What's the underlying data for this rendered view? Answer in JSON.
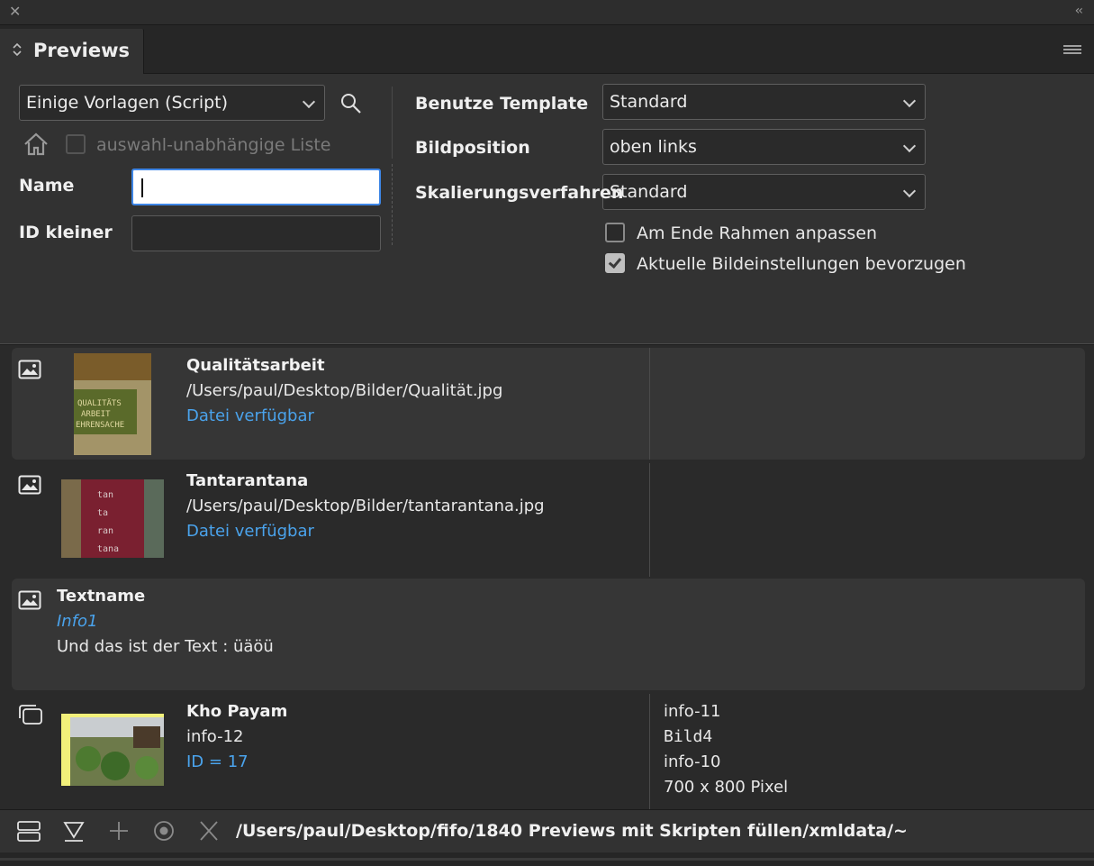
{
  "window": {
    "close_icon": "close-icon",
    "collapse_icon": "double-chevron-left-icon",
    "collapse_glyph": "‹‹"
  },
  "tab": {
    "title": "Previews"
  },
  "controls": {
    "preset_select": "Einige Vorlagen (Script)",
    "independent_list_label": "auswahl-unabhängige Liste",
    "name_label": "Name",
    "name_value": "",
    "id_label": "ID kleiner",
    "id_value": "",
    "template_label": "Benutze Template",
    "template_value": "Standard",
    "position_label": "Bildposition",
    "position_value": "oben links",
    "scaling_label": "Skalierungsverfahren",
    "scaling_value": "Standard",
    "fit_frame_label": "Am Ende Rahmen anpassen",
    "fit_frame_checked": false,
    "prefer_current_label": "Aktuelle Bildeinstellungen bevorzugen",
    "prefer_current_checked": true
  },
  "entries": [
    {
      "title": "Qualitätsarbeit",
      "path": "/Users/paul/Desktop/Bilder/Qualität.jpg",
      "status": "Datei verfügbar"
    },
    {
      "title": "Tantarantana",
      "path": "/Users/paul/Desktop/Bilder/tantarantana.jpg",
      "status": "Datei verfügbar"
    },
    {
      "title": "Textname",
      "info": "Info1",
      "text": "Und das ist der Text : üäöü"
    },
    {
      "title": "Kho Payam",
      "info": "info-12",
      "id": "ID = 17",
      "meta": [
        "info-11",
        "Bild4",
        "info-10",
        "700 x 800 Pixel"
      ]
    }
  ],
  "footer": {
    "path": "/Users/paul/Desktop/fifo/1840 Previews mit Skripten füllen/xmldata/~"
  },
  "colors": {
    "accent": "#4aa3ec",
    "panel": "#323232",
    "focus": "#3e86e6"
  }
}
